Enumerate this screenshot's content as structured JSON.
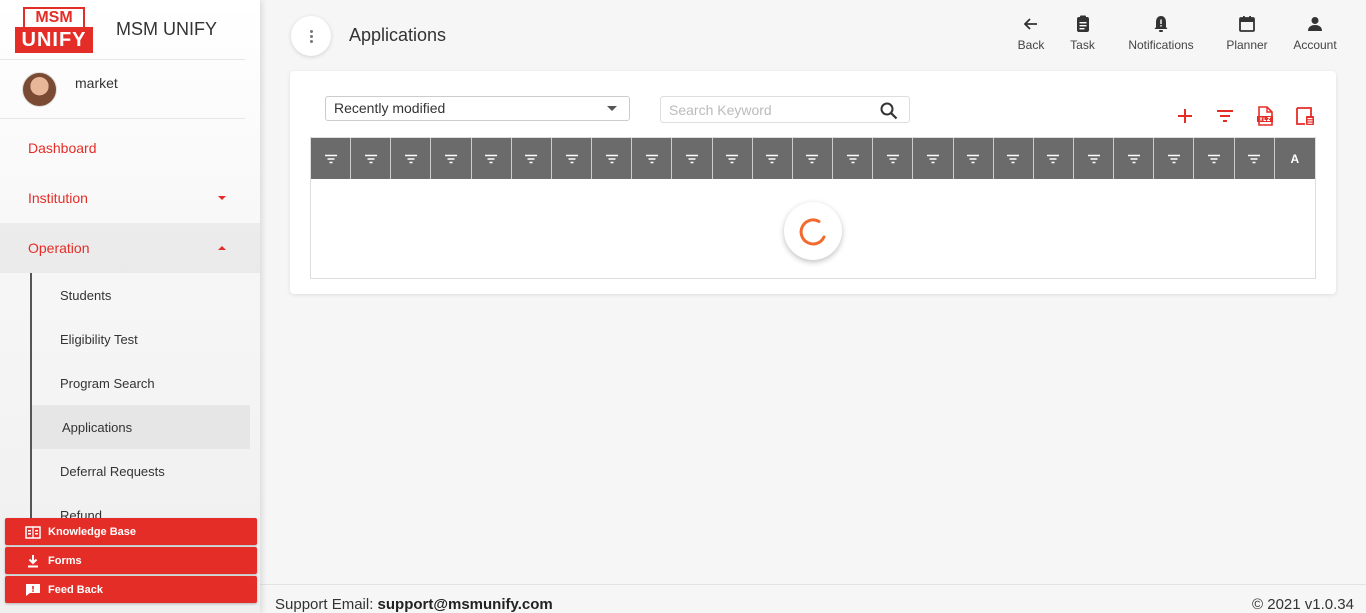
{
  "brand": {
    "logo_top": "MSM",
    "logo_bottom": "UNIFY",
    "name": "MSM UNIFY",
    "primary_color": "#e52d27"
  },
  "user": {
    "name": "market"
  },
  "nav": {
    "dashboard": "Dashboard",
    "institution": "Institution",
    "operation": "Operation",
    "sub_items": [
      "Students",
      "Eligibility Test",
      "Program Search",
      "Applications",
      "Deferral Requests",
      "Refund"
    ],
    "active": "Applications"
  },
  "bottom_buttons": {
    "knowledge_base": "Knowledge Base",
    "forms": "Forms",
    "feedback": "Feed Back"
  },
  "header": {
    "title": "Applications",
    "actions": {
      "back": "Back",
      "task": "Task",
      "notifications": "Notifications",
      "planner": "Planner",
      "account": "Account"
    }
  },
  "filters": {
    "sort_selected": "Recently modified",
    "search_placeholder": "Search Keyword"
  },
  "table": {
    "last_header_label": "A",
    "filter_columns": 24
  },
  "footer": {
    "support_label": "Support Email: ",
    "support_email": "support@msmunify.com",
    "version": "© 2021 v1.0.34"
  }
}
